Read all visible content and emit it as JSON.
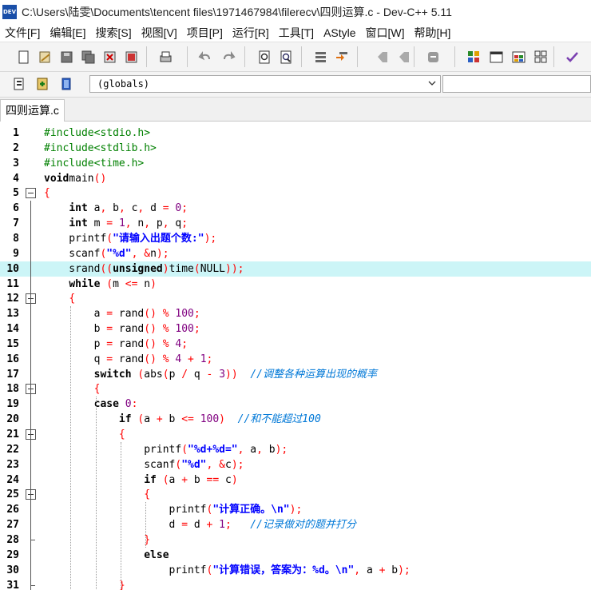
{
  "window": {
    "title": "C:\\Users\\陆雯\\Documents\\tencent files\\1971467984\\filerecv\\四则运算.c - Dev-C++ 5.11",
    "icon_label": "DEV"
  },
  "menu": [
    "文件[F]",
    "编辑[E]",
    "搜索[S]",
    "视图[V]",
    "项目[P]",
    "运行[R]",
    "工具[T]",
    "AStyle",
    "窗口[W]",
    "帮助[H]"
  ],
  "toolbar": {
    "buttons": [
      "new-file-icon",
      "open-file-icon",
      "save-icon",
      "save-all-icon",
      "close-icon",
      "close-all-icon",
      "print-icon",
      "undo-icon",
      "redo-icon",
      "find-icon",
      "replace-icon",
      "indent-icon",
      "unindent-icon",
      "toggle-bookmark-icon",
      "goto-bookmark-icon",
      "comment-icon",
      "compile-icon",
      "run-icon",
      "compile-run-icon",
      "rebuild-icon",
      "syntax-check-icon"
    ]
  },
  "toolbar2": {
    "scope_value": "(globals)",
    "buttons": [
      "new-class-icon",
      "insert-icon",
      "toggle-icon"
    ]
  },
  "tab": {
    "label": "四则运算.c"
  },
  "editor": {
    "highlight_line": 10,
    "lines": [
      {
        "n": "1",
        "t": [
          [
            "p",
            "#include<stdio.h>"
          ]
        ]
      },
      {
        "n": "2",
        "t": [
          [
            "p",
            "#include<stdlib.h>"
          ]
        ]
      },
      {
        "n": "3",
        "t": [
          [
            "p",
            "#include<time.h>"
          ]
        ]
      },
      {
        "n": "4",
        "t": [
          [
            "k",
            "void"
          ],
          [
            "",
            "main"
          ],
          [
            "o",
            "()"
          ]
        ]
      },
      {
        "n": "5",
        "t": [
          [
            "o",
            "{"
          ]
        ]
      },
      {
        "n": "6",
        "t": [
          [
            "",
            "    "
          ],
          [
            "k",
            "int"
          ],
          [
            "",
            " a"
          ],
          [
            "o",
            ","
          ],
          [
            "",
            " b"
          ],
          [
            "o",
            ","
          ],
          [
            "",
            " c"
          ],
          [
            "o",
            ","
          ],
          [
            "",
            " d "
          ],
          [
            "o",
            "="
          ],
          [
            "",
            " "
          ],
          [
            "n",
            "0"
          ],
          [
            "o",
            ";"
          ]
        ]
      },
      {
        "n": "7",
        "t": [
          [
            "",
            "    "
          ],
          [
            "k",
            "int"
          ],
          [
            "",
            " m "
          ],
          [
            "o",
            "="
          ],
          [
            "",
            " "
          ],
          [
            "n",
            "1"
          ],
          [
            "o",
            ","
          ],
          [
            "",
            " n"
          ],
          [
            "o",
            ","
          ],
          [
            "",
            " p"
          ],
          [
            "o",
            ","
          ],
          [
            "",
            " q"
          ],
          [
            "o",
            ";"
          ]
        ]
      },
      {
        "n": "8",
        "t": [
          [
            "",
            "    printf"
          ],
          [
            "o",
            "("
          ],
          [
            "s",
            "\"请输入出题个数:\""
          ],
          [
            "o",
            ");"
          ]
        ]
      },
      {
        "n": "9",
        "t": [
          [
            "",
            "    scanf"
          ],
          [
            "o",
            "("
          ],
          [
            "s",
            "\"%d\""
          ],
          [
            "o",
            ","
          ],
          [
            "",
            " "
          ],
          [
            "o",
            "&"
          ],
          [
            "",
            "n"
          ],
          [
            "o",
            ");"
          ]
        ]
      },
      {
        "n": "10",
        "t": [
          [
            "",
            "    srand"
          ],
          [
            "o",
            "(("
          ],
          [
            "k",
            "unsigned"
          ],
          [
            "o",
            ")"
          ],
          [
            "",
            "time"
          ],
          [
            "o",
            "("
          ],
          [
            "",
            "NULL"
          ],
          [
            "o",
            "));"
          ]
        ]
      },
      {
        "n": "11",
        "t": [
          [
            "",
            "    "
          ],
          [
            "k",
            "while"
          ],
          [
            "",
            " "
          ],
          [
            "o",
            "("
          ],
          [
            "",
            "m "
          ],
          [
            "o",
            "<="
          ],
          [
            "",
            " n"
          ],
          [
            "o",
            ")"
          ]
        ]
      },
      {
        "n": "12",
        "t": [
          [
            "",
            "    "
          ],
          [
            "o",
            "{"
          ]
        ]
      },
      {
        "n": "13",
        "t": [
          [
            "",
            "        a "
          ],
          [
            "o",
            "="
          ],
          [
            "",
            " rand"
          ],
          [
            "o",
            "()"
          ],
          [
            "",
            " "
          ],
          [
            "o",
            "%"
          ],
          [
            "",
            " "
          ],
          [
            "n",
            "100"
          ],
          [
            "o",
            ";"
          ]
        ]
      },
      {
        "n": "14",
        "t": [
          [
            "",
            "        b "
          ],
          [
            "o",
            "="
          ],
          [
            "",
            " rand"
          ],
          [
            "o",
            "()"
          ],
          [
            "",
            " "
          ],
          [
            "o",
            "%"
          ],
          [
            "",
            " "
          ],
          [
            "n",
            "100"
          ],
          [
            "o",
            ";"
          ]
        ]
      },
      {
        "n": "15",
        "t": [
          [
            "",
            "        p "
          ],
          [
            "o",
            "="
          ],
          [
            "",
            " rand"
          ],
          [
            "o",
            "()"
          ],
          [
            "",
            " "
          ],
          [
            "o",
            "%"
          ],
          [
            "",
            " "
          ],
          [
            "n",
            "4"
          ],
          [
            "o",
            ";"
          ]
        ]
      },
      {
        "n": "16",
        "t": [
          [
            "",
            "        q "
          ],
          [
            "o",
            "="
          ],
          [
            "",
            " rand"
          ],
          [
            "o",
            "()"
          ],
          [
            "",
            " "
          ],
          [
            "o",
            "%"
          ],
          [
            "",
            " "
          ],
          [
            "n",
            "4"
          ],
          [
            "",
            " "
          ],
          [
            "o",
            "+"
          ],
          [
            "",
            " "
          ],
          [
            "n",
            "1"
          ],
          [
            "o",
            ";"
          ]
        ]
      },
      {
        "n": "17",
        "t": [
          [
            "",
            "        "
          ],
          [
            "k",
            "switch"
          ],
          [
            "",
            " "
          ],
          [
            "o",
            "("
          ],
          [
            "",
            "abs"
          ],
          [
            "o",
            "("
          ],
          [
            "",
            "p "
          ],
          [
            "o",
            "/"
          ],
          [
            "",
            " q "
          ],
          [
            "o",
            "-"
          ],
          [
            "",
            " "
          ],
          [
            "n",
            "3"
          ],
          [
            "o",
            "))"
          ],
          [
            "",
            "  "
          ],
          [
            "c",
            "//调整各种运算出现的概率"
          ]
        ]
      },
      {
        "n": "18",
        "t": [
          [
            "",
            "        "
          ],
          [
            "o",
            "{"
          ]
        ]
      },
      {
        "n": "19",
        "t": [
          [
            "",
            "        "
          ],
          [
            "k",
            "case"
          ],
          [
            "",
            " "
          ],
          [
            "n",
            "0"
          ],
          [
            "o",
            ":"
          ]
        ]
      },
      {
        "n": "20",
        "t": [
          [
            "",
            "            "
          ],
          [
            "k",
            "if"
          ],
          [
            "",
            " "
          ],
          [
            "o",
            "("
          ],
          [
            "",
            "a "
          ],
          [
            "o",
            "+"
          ],
          [
            "",
            " b "
          ],
          [
            "o",
            "<="
          ],
          [
            "",
            " "
          ],
          [
            "n",
            "100"
          ],
          [
            "o",
            ")"
          ],
          [
            "",
            "  "
          ],
          [
            "c",
            "//和不能超过100"
          ]
        ]
      },
      {
        "n": "21",
        "t": [
          [
            "",
            "            "
          ],
          [
            "o",
            "{"
          ]
        ]
      },
      {
        "n": "22",
        "t": [
          [
            "",
            "                printf"
          ],
          [
            "o",
            "("
          ],
          [
            "s",
            "\"%d+%d=\""
          ],
          [
            "o",
            ","
          ],
          [
            "",
            " a"
          ],
          [
            "o",
            ","
          ],
          [
            "",
            " b"
          ],
          [
            "o",
            ");"
          ]
        ]
      },
      {
        "n": "23",
        "t": [
          [
            "",
            "                scanf"
          ],
          [
            "o",
            "("
          ],
          [
            "s",
            "\"%d\""
          ],
          [
            "o",
            ","
          ],
          [
            "",
            " "
          ],
          [
            "o",
            "&"
          ],
          [
            "",
            "c"
          ],
          [
            "o",
            ");"
          ]
        ]
      },
      {
        "n": "24",
        "t": [
          [
            "",
            "                "
          ],
          [
            "k",
            "if"
          ],
          [
            "",
            " "
          ],
          [
            "o",
            "("
          ],
          [
            "",
            "a "
          ],
          [
            "o",
            "+"
          ],
          [
            "",
            " b "
          ],
          [
            "o",
            "=="
          ],
          [
            "",
            " c"
          ],
          [
            "o",
            ")"
          ]
        ]
      },
      {
        "n": "25",
        "t": [
          [
            "",
            "                "
          ],
          [
            "o",
            "{"
          ]
        ]
      },
      {
        "n": "26",
        "t": [
          [
            "",
            "                    printf"
          ],
          [
            "o",
            "("
          ],
          [
            "s",
            "\"计算正确。\\n\""
          ],
          [
            "o",
            ");"
          ]
        ]
      },
      {
        "n": "27",
        "t": [
          [
            "",
            "                    d "
          ],
          [
            "o",
            "="
          ],
          [
            "",
            " d "
          ],
          [
            "o",
            "+"
          ],
          [
            "",
            " "
          ],
          [
            "n",
            "1"
          ],
          [
            "o",
            ";"
          ],
          [
            "",
            "   "
          ],
          [
            "c",
            "//记录做对的题并打分"
          ]
        ]
      },
      {
        "n": "28",
        "t": [
          [
            "",
            "                "
          ],
          [
            "o",
            "}"
          ]
        ]
      },
      {
        "n": "29",
        "t": [
          [
            "",
            "                "
          ],
          [
            "k",
            "else"
          ]
        ]
      },
      {
        "n": "30",
        "t": [
          [
            "",
            "                    printf"
          ],
          [
            "o",
            "("
          ],
          [
            "s",
            "\"计算错误，答案为：%d。\\n\""
          ],
          [
            "o",
            ","
          ],
          [
            "",
            " a "
          ],
          [
            "o",
            "+"
          ],
          [
            "",
            " b"
          ],
          [
            "o",
            ");"
          ]
        ]
      },
      {
        "n": "31",
        "t": [
          [
            "",
            "            "
          ],
          [
            "o",
            "}"
          ]
        ]
      }
    ],
    "fold_open_lines": [
      5,
      12,
      18,
      21,
      25
    ],
    "fold_end_lines": [
      28,
      31
    ]
  }
}
